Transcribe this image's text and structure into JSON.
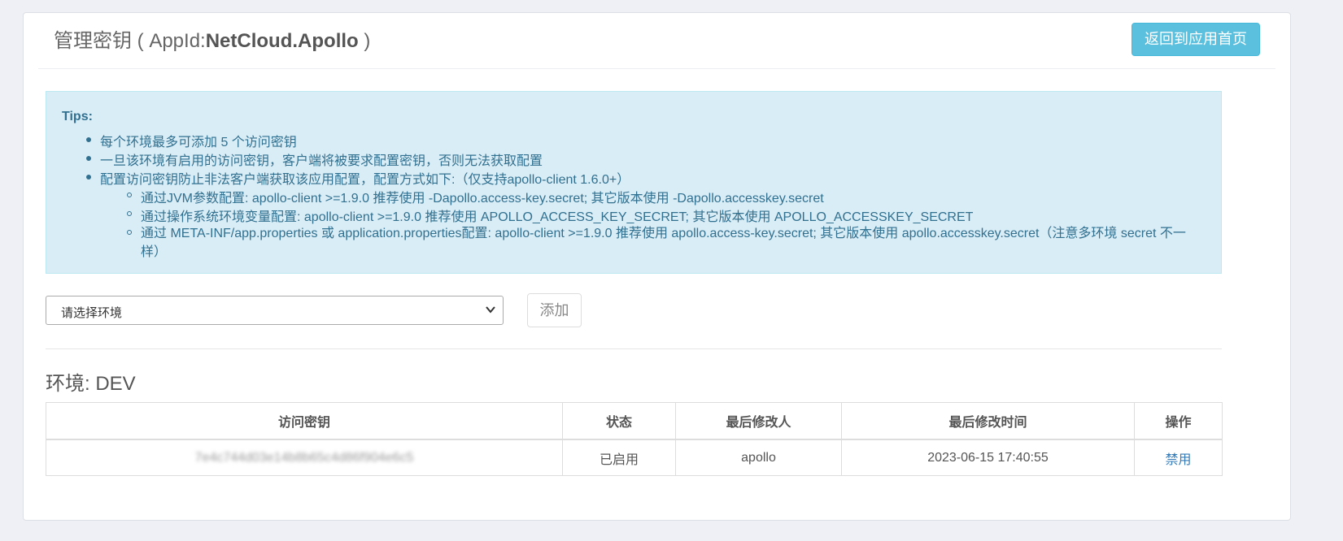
{
  "header": {
    "title_prefix": "管理密钥 ( AppId:",
    "app_id": "NetCloud.Apollo",
    "title_suffix": " )",
    "back_button": "返回到应用首页"
  },
  "tips": {
    "title": "Tips:",
    "items": [
      "每个环境最多可添加 5 个访问密钥",
      "一旦该环境有启用的访问密钥，客户端将被要求配置密钥，否则无法获取配置",
      "配置访问密钥防止非法客户端获取该应用配置，配置方式如下:（仅支持apollo-client 1.6.0+）"
    ],
    "subitems": [
      "通过JVM参数配置: apollo-client >=1.9.0 推荐使用 -Dapollo.access-key.secret; 其它版本使用 -Dapollo.accesskey.secret",
      "通过操作系统环境变量配置: apollo-client >=1.9.0 推荐使用 APOLLO_ACCESS_KEY_SECRET; 其它版本使用 APOLLO_ACCESSKEY_SECRET",
      "通过 META-INF/app.properties 或 application.properties配置: apollo-client >=1.9.0 推荐使用 apollo.access-key.secret; 其它版本使用 apollo.accesskey.secret（注意多环境 secret 不一样）"
    ]
  },
  "env_select": {
    "placeholder": "请选择环境"
  },
  "add_button": "添加",
  "env_section": {
    "title": "环境: DEV",
    "columns": [
      "访问密钥",
      "状态",
      "最后修改人",
      "最后修改时间",
      "操作"
    ],
    "rows": [
      {
        "secret": "7e4c744d03e14b8b65c4d86f904e6c5",
        "status": "已启用",
        "modifier": "apollo",
        "modified_time": "2023-06-15 17:40:55",
        "action": "禁用"
      }
    ]
  },
  "colors": {
    "info_bg": "#d9edf7",
    "info_text": "#31708f",
    "primary_btn": "#5bc0de",
    "enabled": "#3c9a3c",
    "link": "#337ab7"
  }
}
